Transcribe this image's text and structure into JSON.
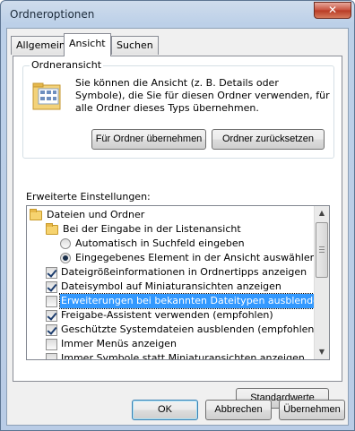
{
  "window": {
    "title": "Ordneroptionen",
    "close_label": "✕"
  },
  "tabs": [
    {
      "label": "Allgemein",
      "active": false
    },
    {
      "label": "Ansicht",
      "active": true
    },
    {
      "label": "Suchen",
      "active": false
    }
  ],
  "folder_view": {
    "group_label": "Ordneransicht",
    "description": "Sie können die Ansicht (z. B. Details oder Symbole), die Sie für diesen Ordner verwenden, für alle Ordner dieses Typs übernehmen.",
    "apply_label": "Für Ordner übernehmen",
    "reset_label": "Ordner zurücksetzen"
  },
  "advanced": {
    "label": "Erweiterte Einstellungen:",
    "items": [
      {
        "type": "folder",
        "label": "Dateien und Ordner",
        "level": 0
      },
      {
        "type": "folder",
        "label": "Bei der Eingabe in der Listenansicht",
        "level": 1
      },
      {
        "type": "radio",
        "label": "Automatisch in Suchfeld eingeben",
        "checked": false,
        "level": 2
      },
      {
        "type": "radio",
        "label": "Eingegebenes Element in der Ansicht auswählen",
        "checked": true,
        "level": 2
      },
      {
        "type": "checkbox",
        "label": "Dateigrößeinformationen in Ordnertipps anzeigen",
        "checked": true,
        "level": 1
      },
      {
        "type": "checkbox",
        "label": "Dateisymbol auf Miniaturansichten anzeigen",
        "checked": true,
        "level": 1
      },
      {
        "type": "checkbox",
        "label": "Erweiterungen bei bekannten Dateitypen ausblenden",
        "checked": false,
        "selected": true,
        "level": 1
      },
      {
        "type": "checkbox",
        "label": "Freigabe-Assistent verwenden (empfohlen)",
        "checked": true,
        "level": 1
      },
      {
        "type": "checkbox",
        "label": "Geschützte Systemdateien ausblenden (empfohlen)",
        "checked": true,
        "level": 1
      },
      {
        "type": "checkbox",
        "label": "Immer Menüs anzeigen",
        "checked": false,
        "level": 1
      },
      {
        "type": "checkbox",
        "label": "Immer Symbole statt Miniaturansichten anzeigen",
        "checked": false,
        "level": 1
      }
    ],
    "defaults_label": "Standardwerte"
  },
  "footer": {
    "ok_label": "OK",
    "cancel_label": "Abbrechen",
    "apply_label": "Übernehmen"
  }
}
